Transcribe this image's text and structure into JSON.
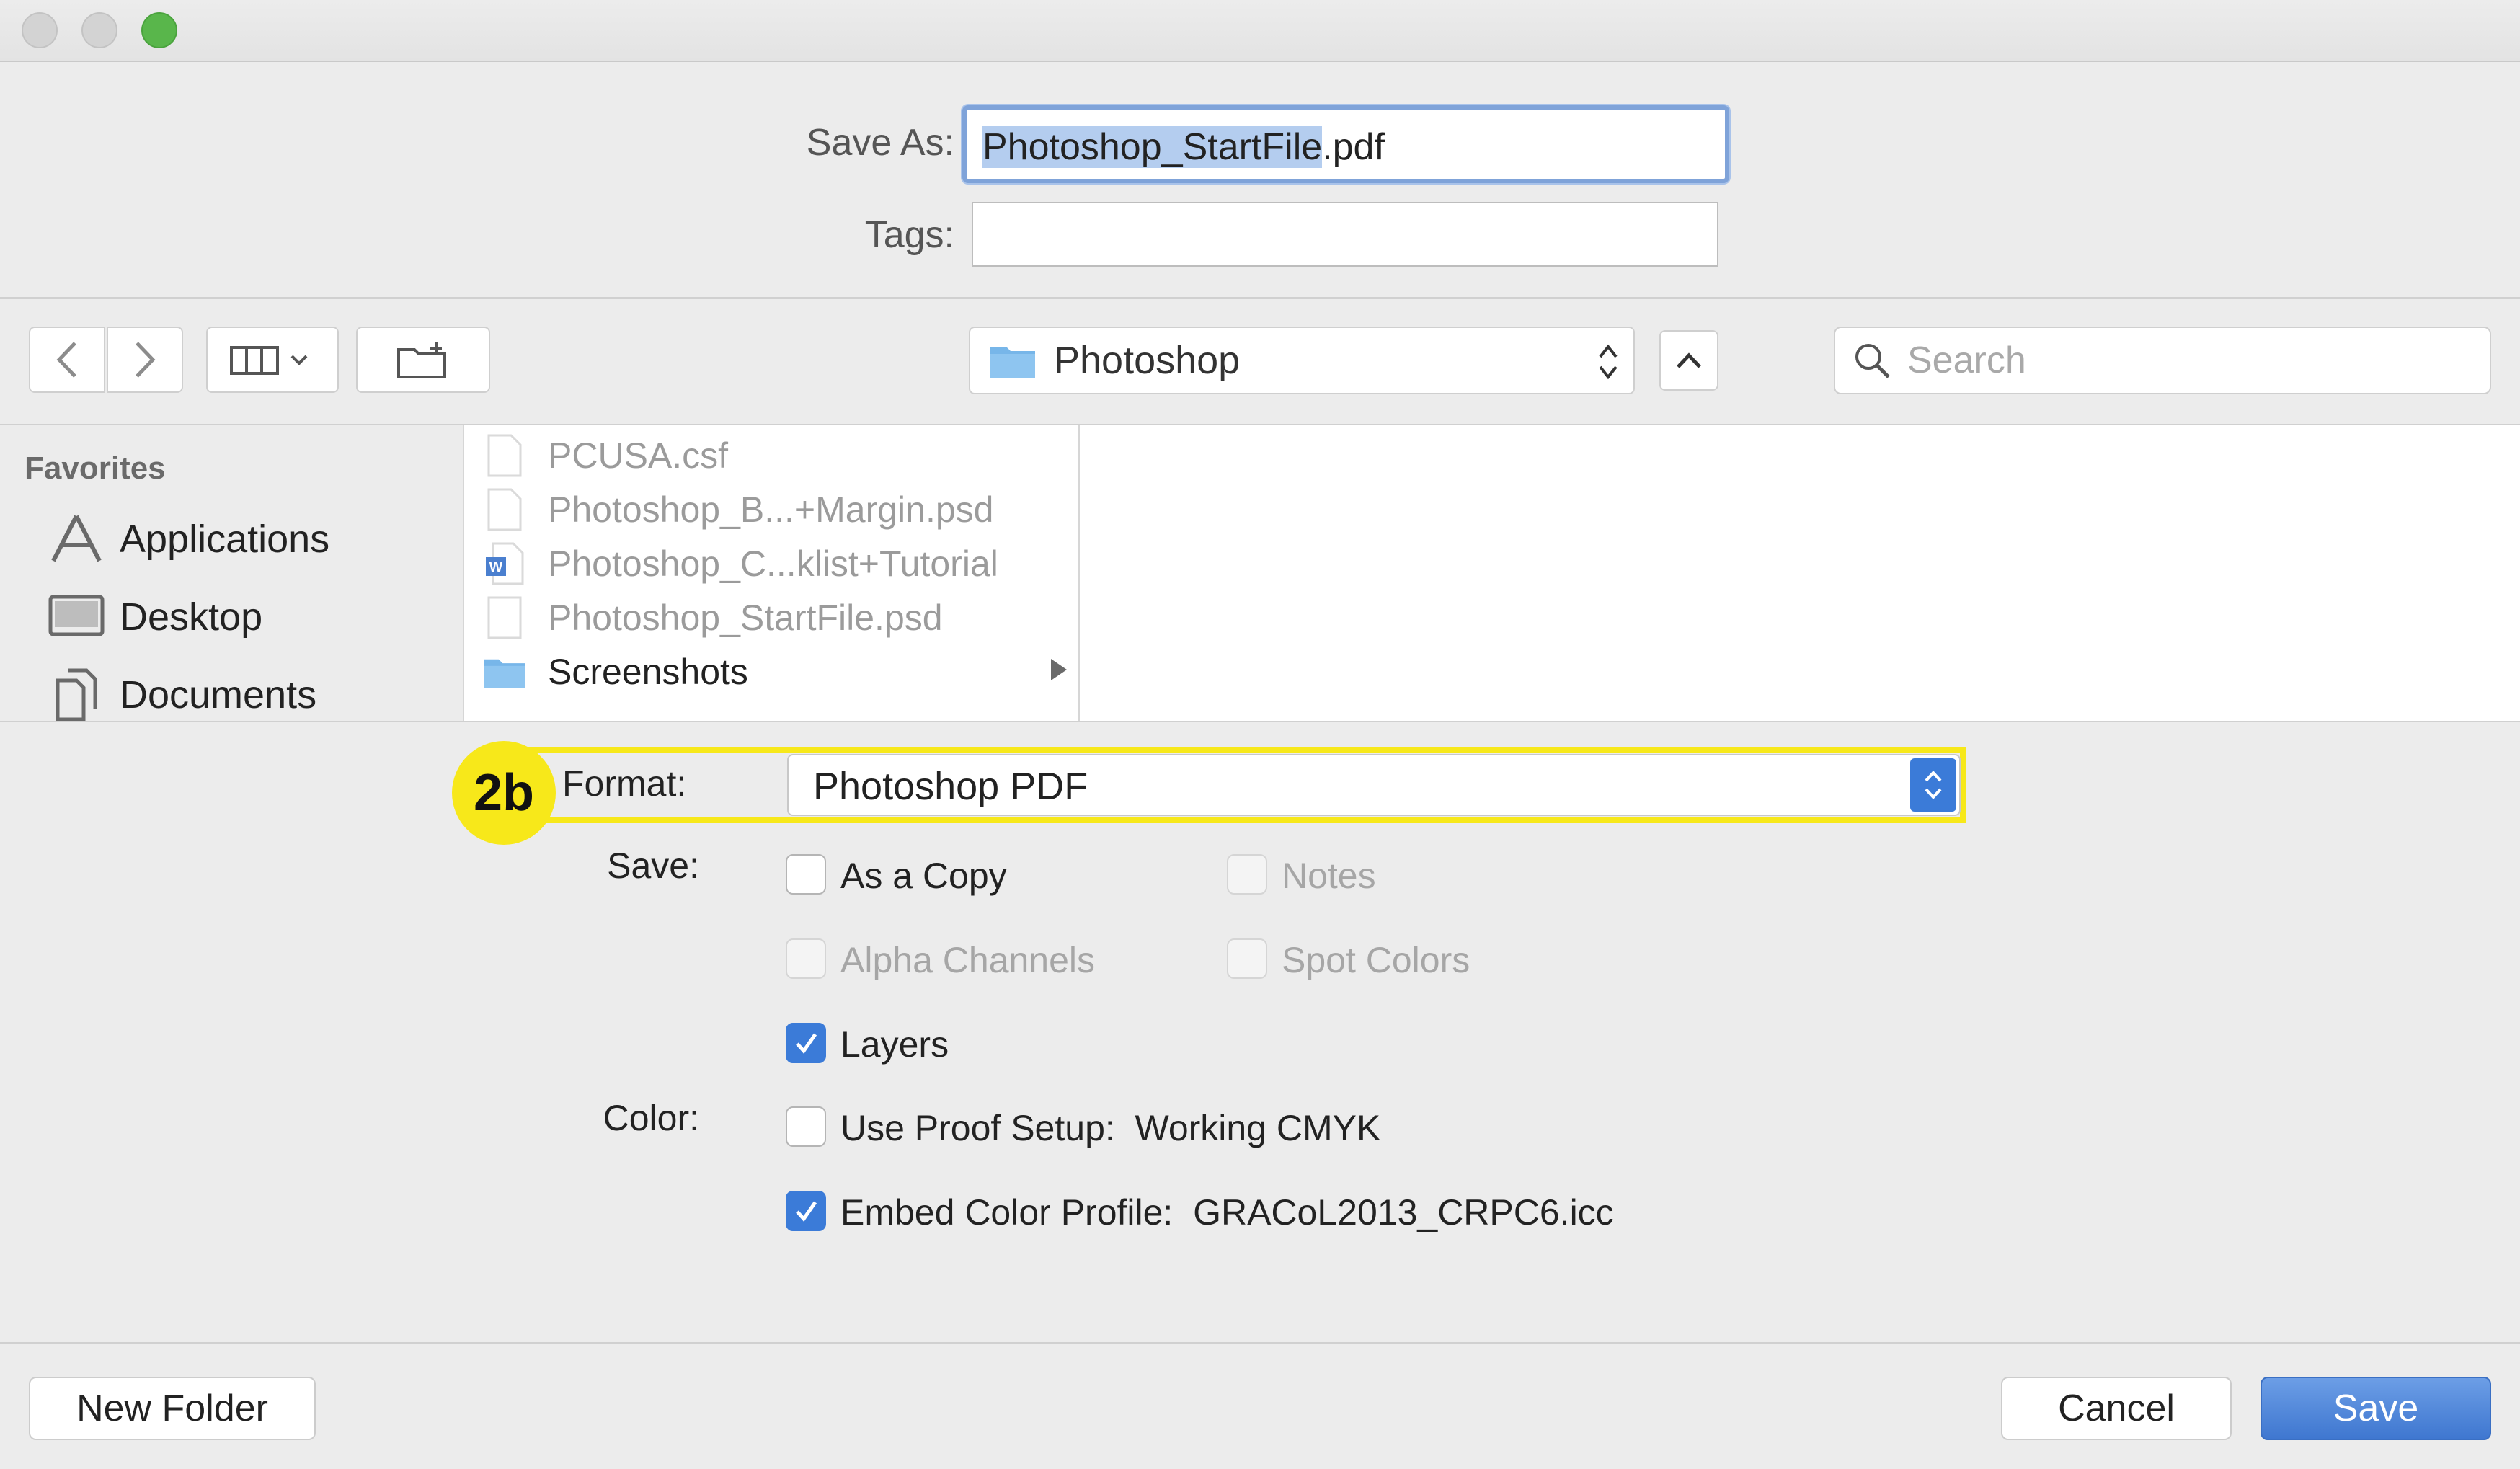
{
  "dialog": {
    "save_as_label": "Save As:",
    "save_as_selected": "Photoshop_StartFile",
    "save_as_ext": ".pdf",
    "tags_label": "Tags:",
    "tags_value": ""
  },
  "toolbar": {
    "location": "Photoshop",
    "search_placeholder": "Search"
  },
  "sidebar": {
    "heading": "Favorites",
    "items": [
      {
        "label": "Applications",
        "icon": "applications-icon"
      },
      {
        "label": "Desktop",
        "icon": "desktop-icon"
      },
      {
        "label": "Documents",
        "icon": "documents-icon"
      }
    ]
  },
  "files": [
    {
      "name": "PCUSA.csf",
      "icon": "document-icon",
      "enabled": false
    },
    {
      "name": "Photoshop_B...+Margin.psd",
      "icon": "document-icon",
      "enabled": false
    },
    {
      "name": "Photoshop_C...klist+Tutorial",
      "icon": "word-document-icon",
      "enabled": false
    },
    {
      "name": "Photoshop_StartFile.psd",
      "icon": "document-icon",
      "enabled": false
    },
    {
      "name": "Screenshots",
      "icon": "folder-icon",
      "enabled": true
    }
  ],
  "options": {
    "callout": "2b",
    "callout_color": "#f7e81a",
    "format_label": "Format:",
    "format_value": "Photoshop PDF",
    "save_label": "Save:",
    "as_copy": {
      "label": "As a Copy",
      "checked": false,
      "enabled": true
    },
    "notes": {
      "label": "Notes",
      "checked": false,
      "enabled": false
    },
    "alpha": {
      "label": "Alpha Channels",
      "checked": false,
      "enabled": false
    },
    "spot": {
      "label": "Spot Colors",
      "checked": false,
      "enabled": false
    },
    "layers": {
      "label": "Layers",
      "checked": true,
      "enabled": true
    },
    "color_label": "Color:",
    "proof": {
      "label": "Use Proof Setup:  Working CMYK",
      "checked": false,
      "enabled": true
    },
    "embed": {
      "label": "Embed Color Profile:  GRACoL2013_CRPC6.icc",
      "checked": true,
      "enabled": true
    }
  },
  "footer": {
    "new_folder": "New Folder",
    "cancel": "Cancel",
    "save": "Save"
  },
  "colors": {
    "accent": "#3b7bd8",
    "focus_ring": "#7fa3d9",
    "zoom_button": "#59b64b"
  }
}
